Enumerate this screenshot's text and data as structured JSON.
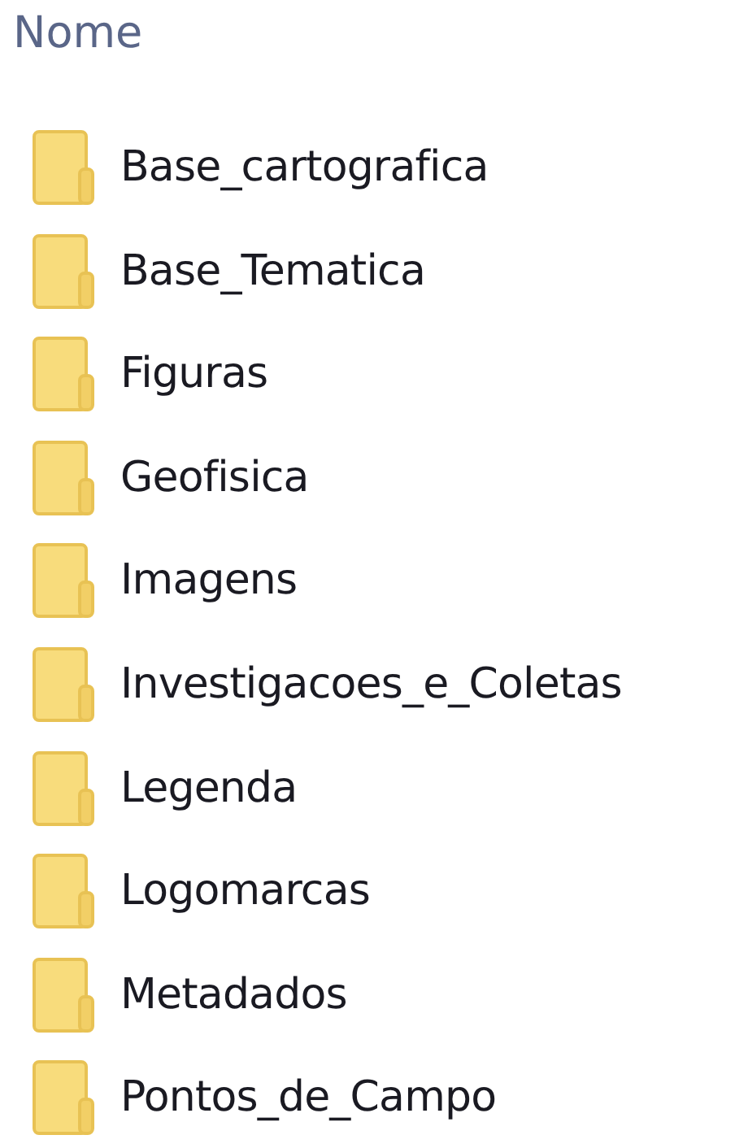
{
  "header": {
    "label": "Nome"
  },
  "items": [
    {
      "name": "Base_cartografica"
    },
    {
      "name": "Base_Tematica"
    },
    {
      "name": "Figuras"
    },
    {
      "name": "Geofisica"
    },
    {
      "name": "Imagens"
    },
    {
      "name": "Investigacoes_e_Coletas"
    },
    {
      "name": "Legenda"
    },
    {
      "name": "Logomarcas"
    },
    {
      "name": "Metadados"
    },
    {
      "name": "Pontos_de_Campo"
    }
  ]
}
